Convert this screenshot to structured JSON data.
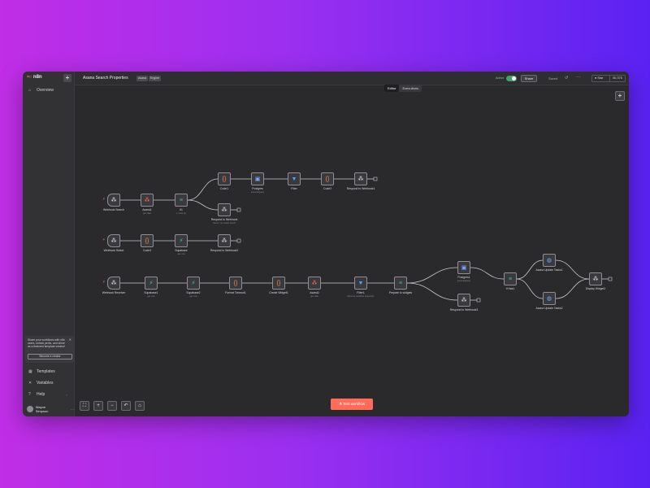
{
  "app": {
    "logo_text": "n8n"
  },
  "sidebar": {
    "overview": "Overview",
    "promo_text": "Share your workflows with n8n users, unlock perks, and shine as a featured template creator!",
    "promo_button": "Become a creator",
    "templates": "Templates",
    "variables": "Variables",
    "help": "Help",
    "user_name": "Wayne Simpson"
  },
  "header": {
    "title": "Asana Search Properties",
    "tags": [
      "Asana",
      "Engine"
    ],
    "status_label": "Active",
    "share": "Share",
    "saved": "Saved",
    "github_star": "Star",
    "github_count": "50,375"
  },
  "tabs": [
    "Editor",
    "Executions"
  ],
  "nodes": [
    {
      "id": "n1",
      "label": "Webhook Search",
      "sub": "",
      "icon": "webhook-icon",
      "color": "#e0e0e0"
    },
    {
      "id": "n2",
      "label": "Asana1",
      "sub": "get: task",
      "icon": "asana-icon",
      "color": "#ff6d5a"
    },
    {
      "id": "n3",
      "label": "If1",
      "sub": "1 more op",
      "icon": "if-icon",
      "color": "#3fbf6a"
    },
    {
      "id": "n4",
      "label": "Code1",
      "sub": "",
      "icon": "code-icon",
      "color": "#ff8a3d"
    },
    {
      "id": "n5",
      "label": "Postgres",
      "sub": "executeQuery",
      "icon": "postgres-icon",
      "color": "#7aa8ff"
    },
    {
      "id": "n6",
      "label": "Filter",
      "sub": "",
      "icon": "filter-icon",
      "color": "#4da6ff"
    },
    {
      "id": "n7",
      "label": "Code2",
      "sub": "",
      "icon": "code-icon",
      "color": "#ff8a3d"
    },
    {
      "id": "n8",
      "label": "Respond to Webhook4",
      "sub": "",
      "icon": "respond-icon",
      "color": "#e0e0e0"
    },
    {
      "id": "n9",
      "label": "Respond to Webhook",
      "sub": "Return 'no results found'",
      "icon": "respond-icon",
      "color": "#e0e0e0"
    },
    {
      "id": "n10",
      "label": "Webhook Select",
      "sub": "",
      "icon": "webhook-icon",
      "color": "#e0e0e0"
    },
    {
      "id": "n11",
      "label": "Code3",
      "sub": "",
      "icon": "code-icon",
      "color": "#ff8a3d"
    },
    {
      "id": "n12",
      "label": "Supabase",
      "sub": "get: row",
      "icon": "supabase-icon",
      "color": "#3fcf8e"
    },
    {
      "id": "n13",
      "label": "Respond to Webhook2",
      "sub": "",
      "icon": "respond-icon",
      "color": "#e0e0e0"
    },
    {
      "id": "n14",
      "label": "Webhook Receiver",
      "sub": "",
      "icon": "webhook-icon",
      "color": "#e0e0e0"
    },
    {
      "id": "n15",
      "label": "Supabase1",
      "sub": "get: row",
      "icon": "supabase-icon",
      "color": "#3fcf8e"
    },
    {
      "id": "n16",
      "label": "Supabase2",
      "sub": "get: row",
      "icon": "supabase-icon",
      "color": "#3fcf8e"
    },
    {
      "id": "n17",
      "label": "Format Timeout1",
      "sub": "",
      "icon": "code-icon",
      "color": "#ff8a3d"
    },
    {
      "id": "n18",
      "label": "Create Widget1",
      "sub": "",
      "icon": "code-icon",
      "color": "#ff8a3d"
    },
    {
      "id": "n19",
      "label": "Asana2",
      "sub": "get: task",
      "icon": "asana-icon",
      "color": "#ff6d5a"
    },
    {
      "id": "n20",
      "label": "Filter1",
      "sub": "Remove workflow properties",
      "icon": "filter-icon",
      "color": "#4da6ff"
    },
    {
      "id": "n21",
      "label": "Prepare to widgets",
      "sub": "",
      "icon": "if-icon",
      "color": "#3fbf6a"
    },
    {
      "id": "n22",
      "label": "Postgres1",
      "sub": "executeQuery",
      "icon": "postgres-icon",
      "color": "#7aa8ff"
    },
    {
      "id": "n23",
      "label": "Respond to Webhook3",
      "sub": "",
      "icon": "respond-icon",
      "color": "#e0e0e0"
    },
    {
      "id": "n24",
      "label": "If Has1",
      "sub": "",
      "icon": "if-icon",
      "color": "#3fbf6a"
    },
    {
      "id": "n25",
      "label": "Asana Update Tasks1",
      "sub": "",
      "icon": "http-icon",
      "color": "#7aa8ff"
    },
    {
      "id": "n26",
      "label": "Asana Update Tasks2",
      "sub": "",
      "icon": "http-icon",
      "color": "#7aa8ff"
    },
    {
      "id": "n27",
      "label": "Display Widget2",
      "sub": "",
      "icon": "respond-icon",
      "color": "#e0e0e0"
    }
  ],
  "execute_button": "Test workflow",
  "colors": {
    "accent": "#ff6d5a",
    "canvas": "#2a2a2c",
    "active_toggle": "#3fa36b",
    "connector": "#c8c8cc"
  }
}
